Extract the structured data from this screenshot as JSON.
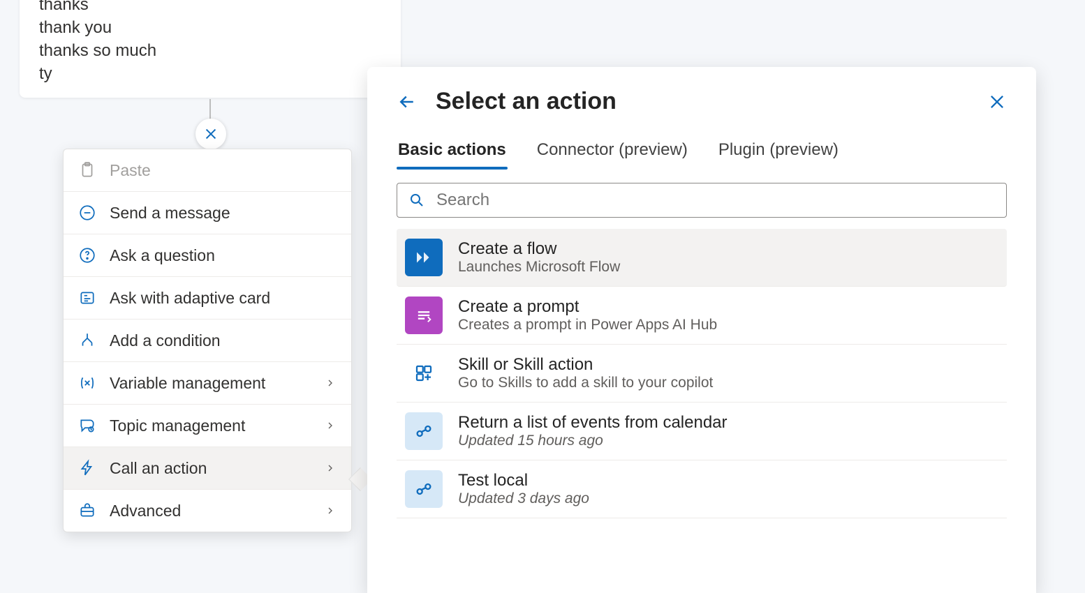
{
  "trigger": {
    "phrases": [
      "thanks",
      "thank you",
      "thanks so much",
      "ty"
    ]
  },
  "menu": {
    "items": [
      {
        "id": "paste",
        "label": "Paste",
        "disabled": true,
        "chevron": false
      },
      {
        "id": "send",
        "label": "Send a message",
        "disabled": false,
        "chevron": false
      },
      {
        "id": "ask",
        "label": "Ask a question",
        "disabled": false,
        "chevron": false
      },
      {
        "id": "adaptive",
        "label": "Ask with adaptive card",
        "disabled": false,
        "chevron": false
      },
      {
        "id": "condition",
        "label": "Add a condition",
        "disabled": false,
        "chevron": false
      },
      {
        "id": "variable",
        "label": "Variable management",
        "disabled": false,
        "chevron": true
      },
      {
        "id": "topic",
        "label": "Topic management",
        "disabled": false,
        "chevron": true
      },
      {
        "id": "call-action",
        "label": "Call an action",
        "disabled": false,
        "chevron": true,
        "selected": true
      },
      {
        "id": "advanced",
        "label": "Advanced",
        "disabled": false,
        "chevron": true
      }
    ]
  },
  "panel": {
    "title": "Select an action",
    "tabs": [
      {
        "id": "basic",
        "label": "Basic actions",
        "active": true
      },
      {
        "id": "connector",
        "label": "Connector (preview)",
        "active": false
      },
      {
        "id": "plugin",
        "label": "Plugin (preview)",
        "active": false
      }
    ],
    "search_placeholder": "Search",
    "actions": [
      {
        "icon": "flow",
        "title": "Create a flow",
        "subtitle": "Launches Microsoft Flow",
        "highlight": true,
        "italic": false
      },
      {
        "icon": "prompt",
        "title": "Create a prompt",
        "subtitle": "Creates a prompt in Power Apps AI Hub",
        "highlight": false,
        "italic": false
      },
      {
        "icon": "skill",
        "title": "Skill or Skill action",
        "subtitle": "Go to Skills to add a skill to your copilot",
        "highlight": false,
        "italic": false
      },
      {
        "icon": "cloud",
        "title": "Return a list of events from calendar",
        "subtitle": "Updated 15 hours ago",
        "highlight": false,
        "italic": true
      },
      {
        "icon": "cloud",
        "title": "Test local",
        "subtitle": "Updated 3 days ago",
        "highlight": false,
        "italic": true
      }
    ]
  }
}
